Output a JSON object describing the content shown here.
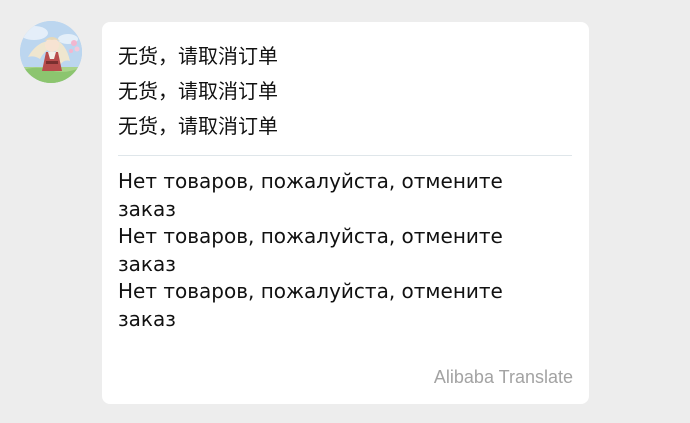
{
  "message": {
    "original_lines": [
      "无货，请取消订单",
      "无货，请取消订单",
      "无货，请取消订单"
    ],
    "translated_lines": [
      "Нет товаров, пожалуйста, отмените заказ",
      "Нет товаров, пожалуйста, отмените заказ",
      "Нет товаров, пожалуйста, отмените заказ"
    ],
    "translation_provider": "Alibaba Translate"
  },
  "colors": {
    "background": "#ededed",
    "bubble": "#ffffff",
    "text": "#111111",
    "provider_text": "#a3a3a3",
    "divider": "#dfe6ea"
  },
  "icons": {
    "avatar": "anime-character-avatar"
  }
}
